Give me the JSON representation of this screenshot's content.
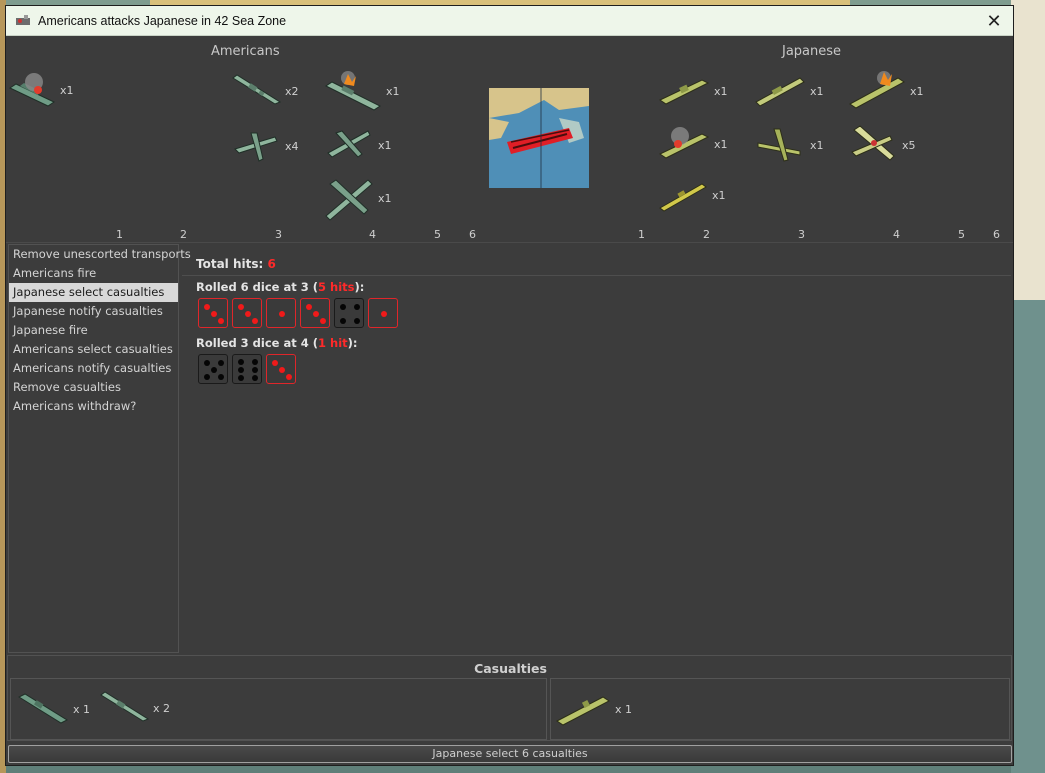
{
  "window": {
    "title": "Americans attacks Japanese in 42 Sea Zone",
    "close": "✕"
  },
  "attacker": {
    "name": "Americans",
    "units": [
      {
        "type": "transport-damaged",
        "count": "x1"
      },
      {
        "type": "destroyer",
        "count": "x2"
      },
      {
        "type": "battleship-damaged",
        "count": "x1"
      },
      {
        "type": "fighter",
        "count": "x4"
      },
      {
        "type": "tactical-bomber",
        "count": "x1"
      },
      {
        "type": "bomber",
        "count": "x1"
      }
    ],
    "dice_positions": [
      "1",
      "2",
      "3",
      "4",
      "5",
      "6"
    ]
  },
  "defender": {
    "name": "Japanese",
    "units": [
      {
        "type": "submarine",
        "count": "x1"
      },
      {
        "type": "cruiser",
        "count": "x1"
      },
      {
        "type": "carrier-damaged",
        "count": "x1"
      },
      {
        "type": "transport-damaged",
        "count": "x1"
      },
      {
        "type": "tactical-bomber",
        "count": "x1"
      },
      {
        "type": "fighter",
        "count": "x5"
      },
      {
        "type": "destroyer",
        "count": "x1"
      }
    ],
    "dice_positions": [
      "1",
      "2",
      "3",
      "4",
      "5",
      "6"
    ]
  },
  "steps": [
    "Remove unescorted transports",
    "Americans fire",
    "Japanese select casualties",
    "Japanese notify casualties",
    "Japanese fire",
    "Americans select casualties",
    "Americans notify casualties",
    "Remove casualties",
    "Americans withdraw?"
  ],
  "selected_step": "Japanese select casualties",
  "dice": {
    "total_label": "Total hits:",
    "total_hits": "6",
    "rolls": [
      {
        "prefix": "Rolled 6 dice at 3 (",
        "hits": "5 hits",
        "suffix": "):",
        "faces": [
          3,
          3,
          1,
          3,
          4,
          1
        ],
        "hit": [
          true,
          true,
          true,
          true,
          false,
          true
        ]
      },
      {
        "prefix": "Rolled 3 dice at 4 (",
        "hits": "1 hit",
        "suffix": "):",
        "faces": [
          5,
          6,
          3
        ],
        "hit": [
          false,
          false,
          true
        ]
      }
    ]
  },
  "casualties": {
    "title": "Casualties",
    "left": [
      {
        "type": "submarine",
        "count": "x 1"
      },
      {
        "type": "destroyer",
        "count": "x 2"
      }
    ],
    "right": [
      {
        "type": "carrier",
        "count": "x 1"
      }
    ]
  },
  "status": "Japanese select 6 casualties",
  "colors": {
    "hit": "#ff2a2a",
    "us_unit": "#7fa58f",
    "jp_unit": "#b9c36a"
  }
}
